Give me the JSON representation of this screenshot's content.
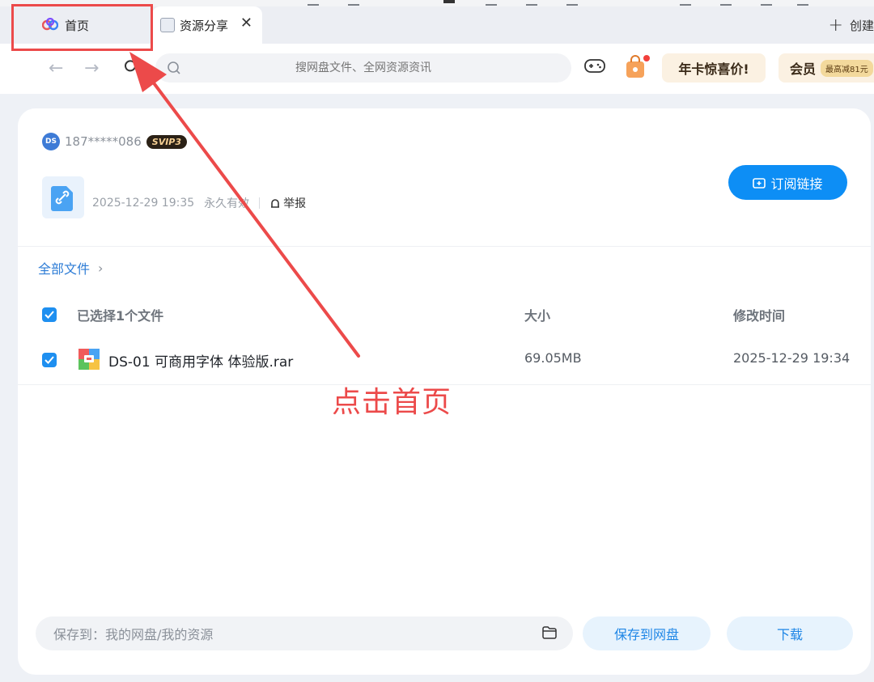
{
  "tabs": {
    "home_label": "首页",
    "share_label": "资源分享",
    "new_tab_label": "创建"
  },
  "search": {
    "placeholder": "搜网盘文件、全网资源资讯"
  },
  "promos": {
    "annual": "年卡惊喜价!",
    "vip_label": "会员",
    "vip_pill": "最高减81元"
  },
  "share_info": {
    "user_id": "187*****086",
    "avatar_text": "DS",
    "vip_badge": "SVIP3",
    "date": "2025-12-29 19:35",
    "validity": "永久有效",
    "report_label": "举报",
    "subscribe_label": "订阅链接"
  },
  "breadcrumb": {
    "label": "全部文件"
  },
  "table": {
    "header_selected": "已选择1个文件",
    "header_size": "大小",
    "header_modified": "修改时间",
    "rows": [
      {
        "name": "DS-01 可商用字体 体验版.rar",
        "size": "69.05MB",
        "modified": "2025-12-29 19:34"
      }
    ]
  },
  "footer": {
    "save_path": "保存到：我的网盘/我的资源",
    "save_button": "保存到网盘",
    "download_button": "下载"
  },
  "annotation": {
    "text": "点击首页"
  },
  "colors": {
    "accent": "#0d8ef5",
    "annotation_red": "#ec4a4a"
  }
}
